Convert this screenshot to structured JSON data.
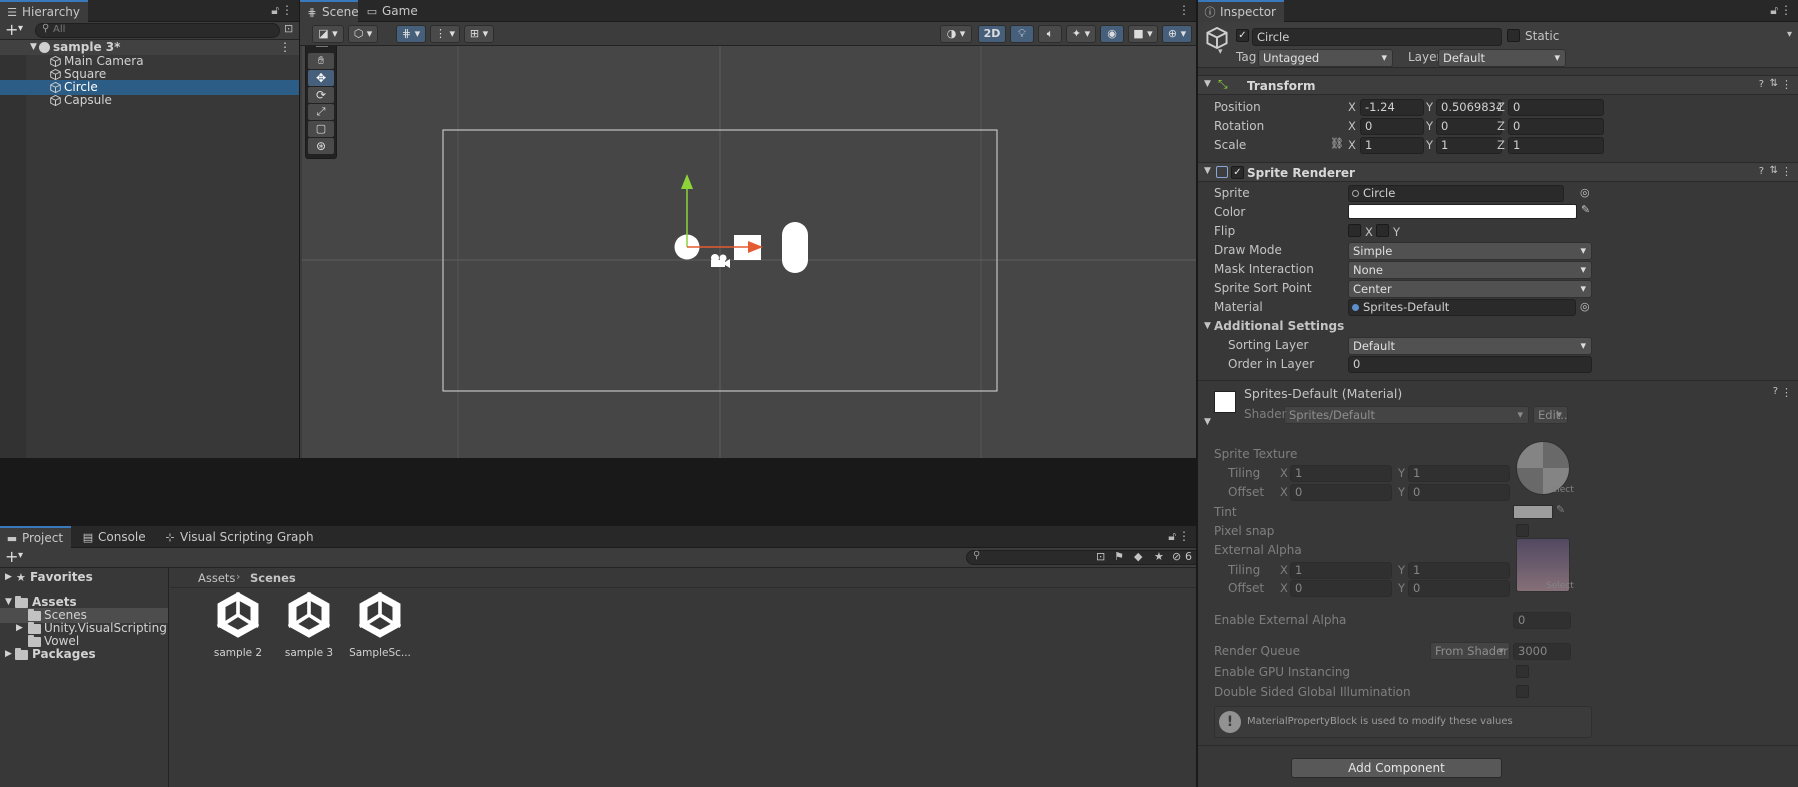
{
  "hierarchy": {
    "tab_label": "Hierarchy",
    "search_placeholder": "All",
    "scene_name": "sample 3*",
    "objects": [
      "Main Camera",
      "Square",
      "Circle",
      "Capsule"
    ],
    "selected": "Circle"
  },
  "scene": {
    "tab_scene": "Scene",
    "tab_game": "Game",
    "mode_2d": "2D"
  },
  "inspector": {
    "tab_label": "Inspector",
    "object_name": "Circle",
    "static_label": "Static",
    "tag_label": "Tag",
    "tag_value": "Untagged",
    "layer_label": "Layer",
    "layer_value": "Default",
    "transform": {
      "title": "Transform",
      "position_label": "Position",
      "rotation_label": "Rotation",
      "scale_label": "Scale",
      "position": {
        "x": "-1.24",
        "y": "0.5069834",
        "z": "0"
      },
      "rotation": {
        "x": "0",
        "y": "0",
        "z": "0"
      },
      "scale": {
        "x": "1",
        "y": "1",
        "z": "1"
      }
    },
    "sprite_renderer": {
      "title": "Sprite Renderer",
      "sprite_label": "Sprite",
      "sprite_value": "Circle",
      "color_label": "Color",
      "color_value": "#ffffff",
      "flip_label": "Flip",
      "flip_x": "X",
      "flip_y": "Y",
      "draw_mode_label": "Draw Mode",
      "draw_mode_value": "Simple",
      "mask_label": "Mask Interaction",
      "mask_value": "None",
      "sort_point_label": "Sprite Sort Point",
      "sort_point_value": "Center",
      "material_label": "Material",
      "material_value": "Sprites-Default",
      "additional_label": "Additional Settings",
      "sorting_layer_label": "Sorting Layer",
      "sorting_layer_value": "Default",
      "order_label": "Order in Layer",
      "order_value": "0"
    },
    "material": {
      "title": "Sprites-Default (Material)",
      "shader_label": "Shader",
      "shader_value": "Sprites/Default",
      "edit_label": "Edit...",
      "sprite_texture_label": "Sprite Texture",
      "tiling_label": "Tiling",
      "offset_label": "Offset",
      "tiling": {
        "x": "1",
        "y": "1"
      },
      "offset": {
        "x": "0",
        "y": "0"
      },
      "select_label": "Select",
      "tint_label": "Tint",
      "pixel_snap_label": "Pixel snap",
      "external_alpha_label": "External Alpha",
      "ext_tiling": {
        "x": "1",
        "y": "1"
      },
      "ext_offset": {
        "x": "0",
        "y": "0"
      },
      "enable_ext_alpha_label": "Enable External Alpha",
      "enable_ext_alpha_value": "0",
      "render_queue_label": "Render Queue",
      "render_queue_mode": "From Shader",
      "render_queue_value": "3000",
      "gpu_instancing_label": "Enable GPU Instancing",
      "double_sided_label": "Double Sided Global Illumination",
      "info_text": "MaterialPropertyBlock is used to modify these values"
    },
    "add_component": "Add Component"
  },
  "project": {
    "tab_project": "Project",
    "tab_console": "Console",
    "tab_vsg": "Visual Scripting Graph",
    "favorites": "Favorites",
    "assets": "Assets",
    "tree": [
      "Scenes",
      "Unity.VisualScripting.Generated",
      "Vowel"
    ],
    "packages": "Packages",
    "breadcrumb": [
      "Assets",
      "Scenes"
    ],
    "hidden_count": "6",
    "files": [
      "sample 2",
      "sample 3",
      "SampleSc..."
    ]
  },
  "colors": {
    "accent": "#3a79bb",
    "selection": "#2c5d87",
    "panel_bg": "#383838",
    "scene_bg": "#464646"
  }
}
